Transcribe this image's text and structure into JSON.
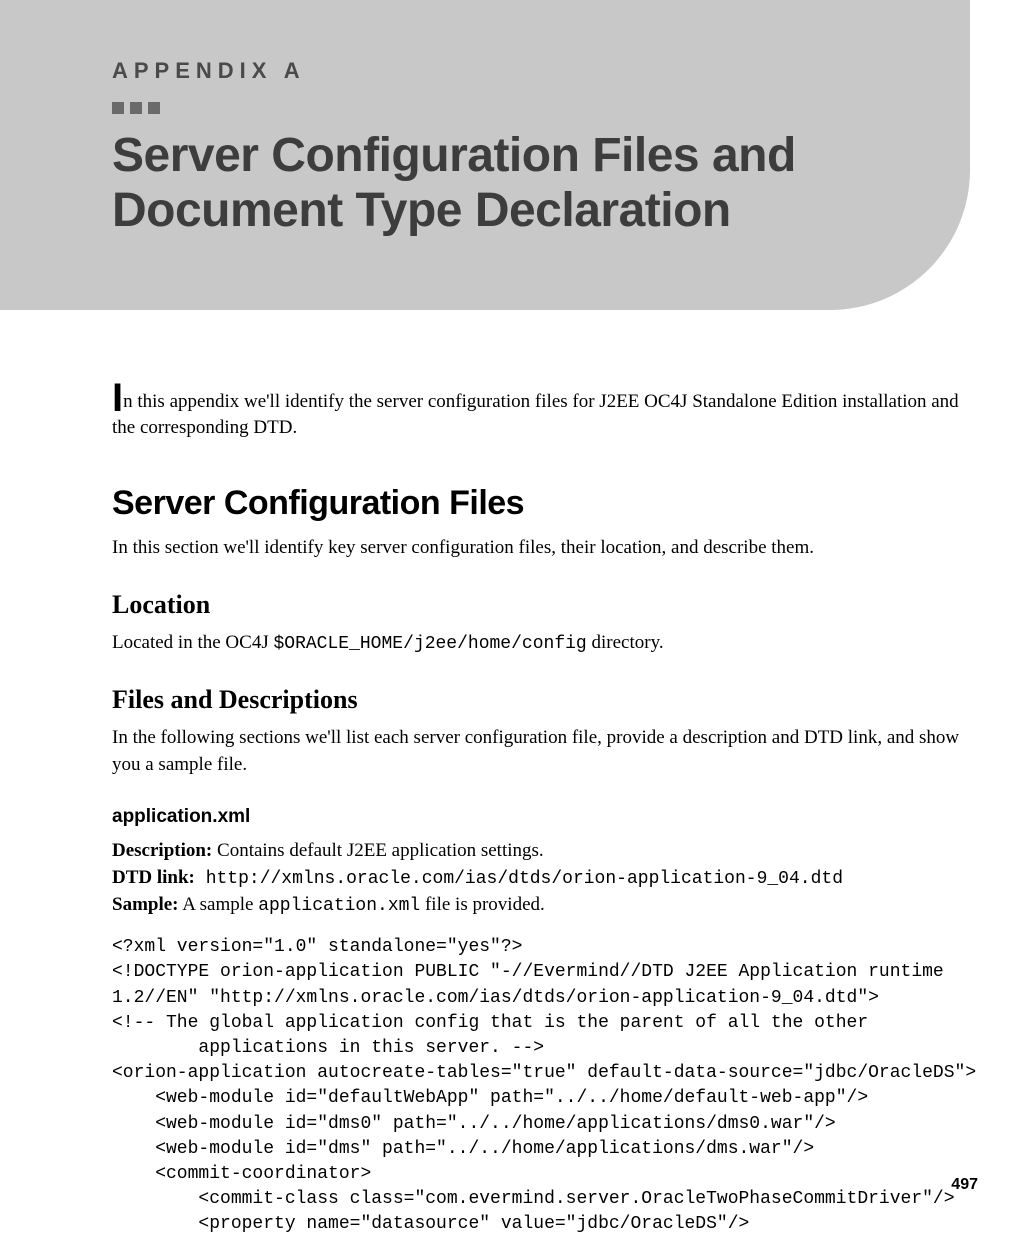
{
  "header": {
    "appendix_label": "APPENDIX A",
    "title_line1": "Server Configuration Files and",
    "title_line2": "Document Type Declaration"
  },
  "intro": {
    "dropcap": "I",
    "rest": "n this appendix we'll identify the server configuration files for J2EE OC4J Standalone Edition installation and the corresponding DTD."
  },
  "section1": {
    "heading": "Server Configuration Files",
    "text": "In this section we'll identify key server configuration files, their location, and describe them."
  },
  "location": {
    "heading": "Location",
    "text_prefix": "Located in the OC4J ",
    "path": "$ORACLE_HOME/j2ee/home/config",
    "text_suffix": " directory."
  },
  "files_desc": {
    "heading": "Files and Descriptions",
    "text": "In the following sections we'll list each server configuration file, provide a description and DTD link, and show you a sample file."
  },
  "appxml": {
    "heading": "application.xml",
    "desc_label": "Description:",
    "desc_value": " Contains default J2EE application settings.",
    "dtd_label": "DTD link:",
    "dtd_value": " http://xmlns.oracle.com/ias/dtds/orion-application-9_04.dtd",
    "sample_label": "Sample:",
    "sample_prefix": " A sample ",
    "sample_file": "application.xml",
    "sample_suffix": " file is provided.",
    "code": "<?xml version=\"1.0\" standalone=\"yes\"?>\n<!DOCTYPE orion-application PUBLIC \"-//Evermind//DTD J2EE Application runtime\n1.2//EN\" \"http://xmlns.oracle.com/ias/dtds/orion-application-9_04.dtd\">\n<!-- The global application config that is the parent of all the other\n        applications in this server. -->\n<orion-application autocreate-tables=\"true\" default-data-source=\"jdbc/OracleDS\">\n    <web-module id=\"defaultWebApp\" path=\"../../home/default-web-app\"/>\n    <web-module id=\"dms0\" path=\"../../home/applications/dms0.war\"/>\n    <web-module id=\"dms\" path=\"../../home/applications/dms.war\"/>\n    <commit-coordinator>\n        <commit-class class=\"com.evermind.server.OracleTwoPhaseCommitDriver\"/>\n        <property name=\"datasource\" value=\"jdbc/OracleDS\"/>"
  },
  "page_number": "497"
}
